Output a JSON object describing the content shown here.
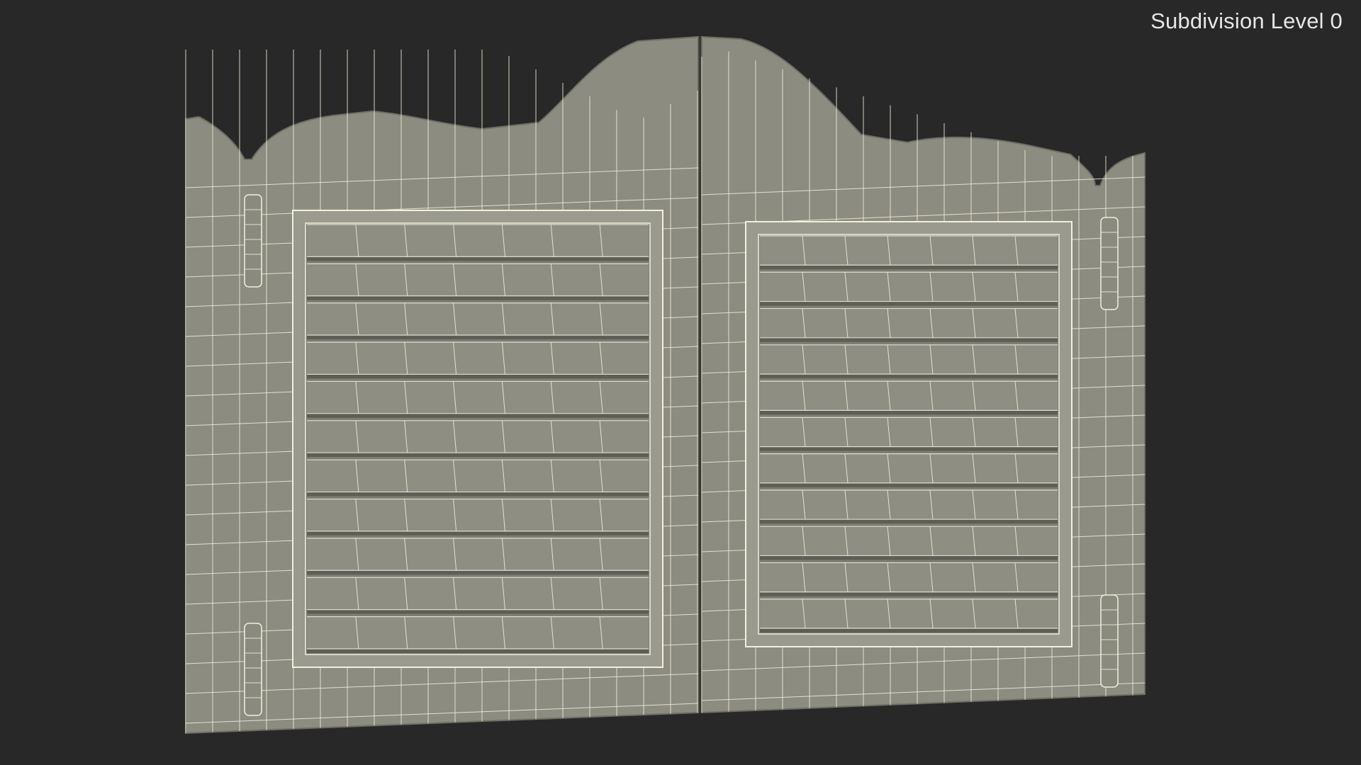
{
  "viewport": {
    "label": "Subdivision Level 0",
    "background_color": "#282828",
    "model_color": "#8c8c80",
    "wire_color": "#f2f0dc"
  },
  "model": {
    "name": "saloon-doors",
    "panels": 2,
    "slats_per_panel": 11,
    "hinges_per_side": 2
  }
}
